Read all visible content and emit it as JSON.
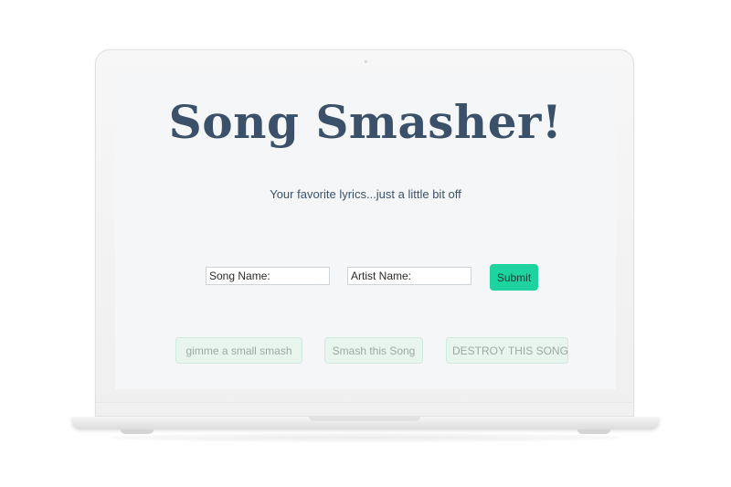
{
  "app": {
    "title": "Song Smasher!",
    "tagline": "Your favorite lyrics...just a little bit off"
  },
  "form": {
    "song_placeholder": "Song Name:",
    "artist_placeholder": "Artist Name:",
    "submit_label": "Submit"
  },
  "actions": [
    {
      "label": "gimme a small smash"
    },
    {
      "label": "Smash this Song"
    },
    {
      "label": "DESTROY THIS SONG"
    }
  ],
  "colors": {
    "title": "#3a5169",
    "submit_bg": "#1fd3a1",
    "smash_bg": "#e7f5ee",
    "smash_text": "#9aaaa3",
    "screen_bg": "#f5f6f7"
  },
  "icons": {
    "device": "laptop-frame",
    "camera": "camera-dot"
  }
}
